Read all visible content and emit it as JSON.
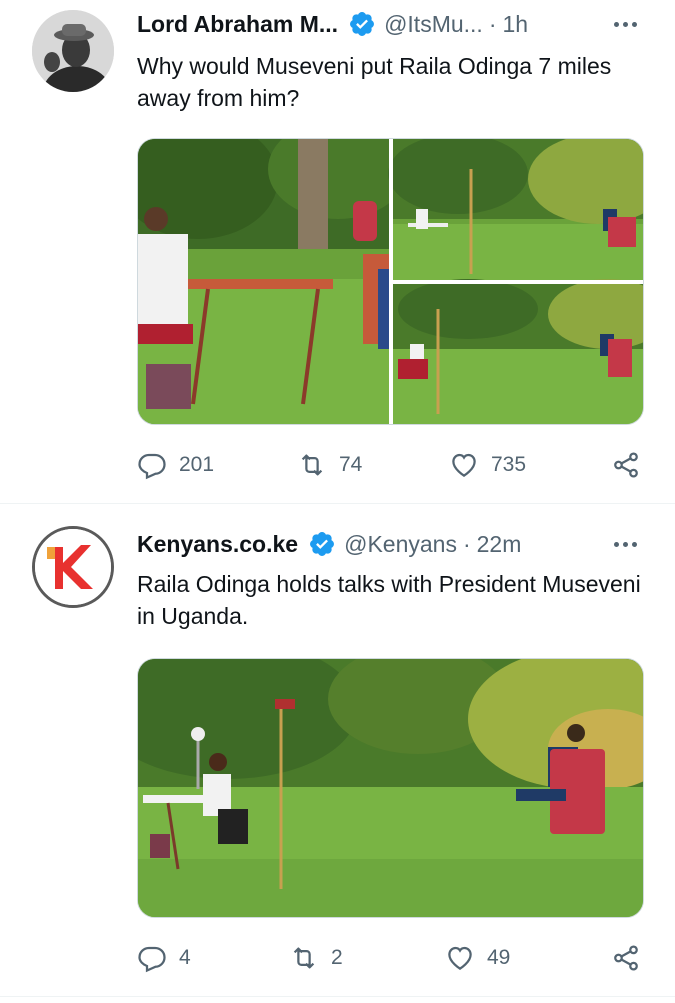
{
  "tweets": [
    {
      "name": "Lord Abraham M...",
      "handle": "@ItsMu...",
      "separator": "·",
      "time": "1h",
      "text": "Why would Museveni put Raila Odinga 7 miles away from him?",
      "media_count": 3,
      "replies": "201",
      "retweets": "74",
      "likes": "735"
    },
    {
      "name": "Kenyans.co.ke",
      "handle": "@Kenyans",
      "separator": "·",
      "time": "22m",
      "text": "Raila Odinga holds talks with President Museveni in Uganda.",
      "media_count": 1,
      "replies": "4",
      "retweets": "2",
      "likes": "49"
    }
  ],
  "icons": {
    "verified": "verified-badge-icon",
    "more": "more-options-icon",
    "reply": "reply-icon",
    "retweet": "retweet-icon",
    "like": "heart-icon",
    "share": "share-icon"
  },
  "colors": {
    "verified_blue": "#1d9bf0",
    "secondary_text": "#536471",
    "primary_text": "#0f1419",
    "divider": "#eff3f4",
    "brand_red": "#e8312f"
  }
}
